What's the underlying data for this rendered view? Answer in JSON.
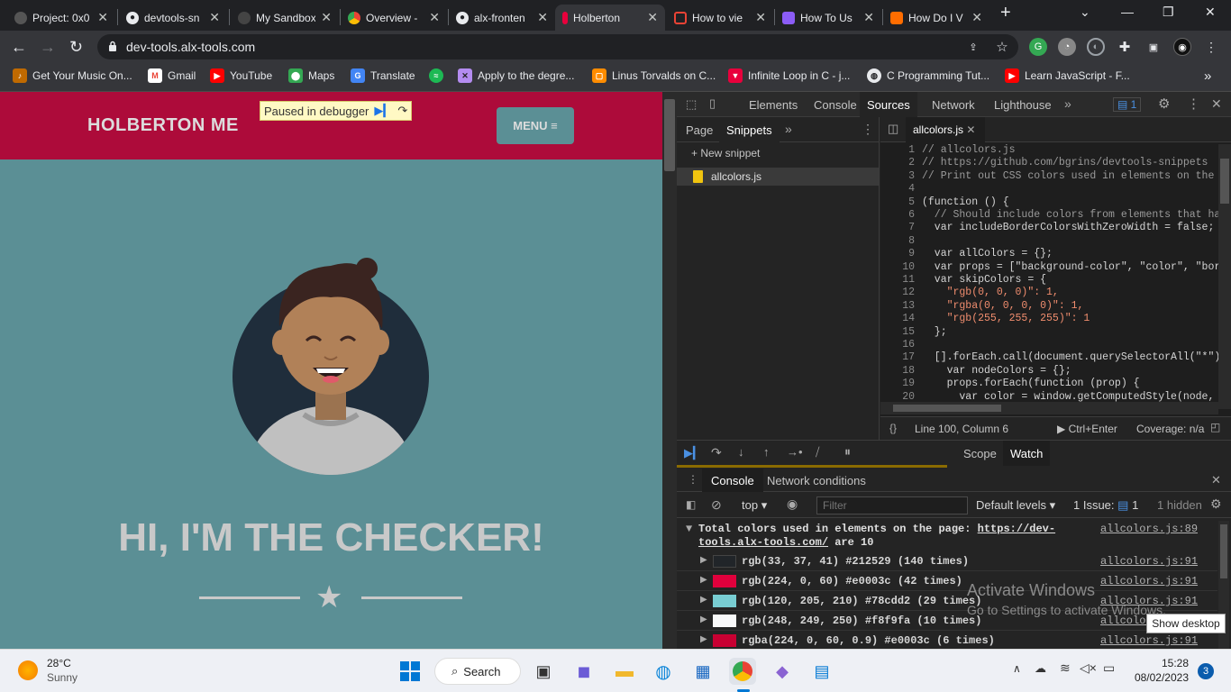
{
  "tabs": [
    {
      "title": "Project: 0x0",
      "icon": "project-icon",
      "color": "#c4c4c4"
    },
    {
      "title": "devtools-sn",
      "icon": "github-icon",
      "color": "#e8eaed"
    },
    {
      "title": "My Sandbox",
      "icon": "sandbox-icon",
      "color": "#e8eaed"
    },
    {
      "title": "Overview -",
      "icon": "chrome-icon",
      "color": "#34a853"
    },
    {
      "title": "alx-fronten",
      "icon": "github-icon",
      "color": "#e8eaed"
    },
    {
      "title": "Holberton",
      "icon": "holberton-icon",
      "color": "#e8003c"
    },
    {
      "title": "How to vie",
      "icon": "page-icon",
      "color": "#ea4335"
    },
    {
      "title": "How To Us",
      "icon": "page-icon",
      "color": "#8b5cf6"
    },
    {
      "title": "How Do I V",
      "icon": "page-icon",
      "color": "#ff6d00"
    }
  ],
  "url": "dev-tools.alx-tools.com",
  "bookmarks": [
    {
      "label": "Get Your Music On...",
      "icon": "music-icon",
      "color": "#ffb300"
    },
    {
      "label": "Gmail",
      "icon": "gmail-icon",
      "color": "#ea4335"
    },
    {
      "label": "YouTube",
      "icon": "youtube-icon",
      "color": "#ff0000"
    },
    {
      "label": "Maps",
      "icon": "maps-icon",
      "color": "#34a853"
    },
    {
      "label": "Translate",
      "icon": "translate-icon",
      "color": "#4285f4"
    },
    {
      "label": "",
      "icon": "spotify-icon",
      "color": "#1db954"
    },
    {
      "label": "Apply to the degre...",
      "icon": "apply-icon",
      "color": "#b48cf0"
    },
    {
      "label": "Linus Torvalds on C...",
      "icon": "linus-icon",
      "color": "#ff8c00"
    },
    {
      "label": "Infinite Loop in C - j...",
      "icon": "infinite-icon",
      "color": "#e8003c"
    },
    {
      "label": "C Programming Tut...",
      "icon": "globe-icon",
      "color": "#e8eaed"
    },
    {
      "label": "Learn JavaScript - F...",
      "icon": "youtube-icon",
      "color": "#ff0000"
    }
  ],
  "page": {
    "brand": "HOLBERTON ME",
    "paused": "Paused in debugger",
    "menu": "MENU ≡",
    "headline": "HI, I'M THE CHECKER!"
  },
  "devtools": {
    "tabs": [
      "Elements",
      "Console",
      "Sources",
      "Network",
      "Lighthouse"
    ],
    "issues_badge": "1",
    "side_tabs": [
      "Page",
      "Snippets"
    ],
    "new_snippet": "+ New snippet",
    "file": "allcolors.js",
    "code_lines": [
      "// allcolors.js",
      "// https://github.com/bgrins/devtools-snippets",
      "// Print out CSS colors used in elements on the pa",
      "",
      "(function () {",
      "  // Should include colors from elements that have",
      "  var includeBorderColorsWithZeroWidth = false;",
      "",
      "  var allColors = {};",
      "  var props = [\"background-color\", \"color\", \"borde",
      "  var skipColors = {",
      "    \"rgb(0, 0, 0)\": 1,",
      "    \"rgba(0, 0, 0, 0)\": 1,",
      "    \"rgb(255, 255, 255)\": 1",
      "  };",
      "",
      "  [].forEach.call(document.querySelectorAll(\"*\"),",
      "    var nodeColors = {};",
      "    props.forEach(function (prop) {",
      "      var color = window.getComputedStyle(node, nu"
    ],
    "status_position": "Line 100, Column 6",
    "run_hint": "Ctrl+Enter",
    "coverage": "Coverage: n/a",
    "scope": "Scope",
    "watch": "Watch",
    "drawer_tabs": [
      "Console",
      "Network conditions"
    ],
    "context": "top",
    "filter_placeholder": "Filter",
    "levels": "Default levels",
    "issues": "1 Issue:",
    "issues_count": "1",
    "hidden": "1 hidden",
    "summary": "Total colors used in elements on the page: ",
    "summary_link": "https://dev-tools.alx-tools.com/",
    "summary_end": " are 10",
    "summary_src": "allcolors.js:89",
    "colors": [
      {
        "text": "rgb(33, 37, 41) #212529 (140 times)",
        "swatch": "#212529",
        "src": "allcolors.js:91"
      },
      {
        "text": "rgb(224, 0, 60) #e0003c (42 times)",
        "swatch": "#e0003c",
        "src": "allcolors.js:91"
      },
      {
        "text": "rgb(120, 205, 210) #78cdd2 (29 times)",
        "swatch": "#78cdd2",
        "src": "allcolors.js:91"
      },
      {
        "text": "rgb(248, 249, 250) #f8f9fa (10 times)",
        "swatch": "#f8f9fa",
        "src": "allcolors.js:91"
      },
      {
        "text": "rgba(224, 0, 60, 0.9) #e0003c (6 times)",
        "swatch": "#c80032",
        "src": "allcolors.js:91"
      }
    ]
  },
  "watermark": {
    "title": "Activate Windows",
    "sub": "Go to Settings to activate Windows."
  },
  "show_desktop": "Show desktop",
  "taskbar": {
    "temp": "28°C",
    "weather": "Sunny",
    "search": "Search",
    "time": "15:28",
    "date": "08/02/2023",
    "notif": "3"
  }
}
